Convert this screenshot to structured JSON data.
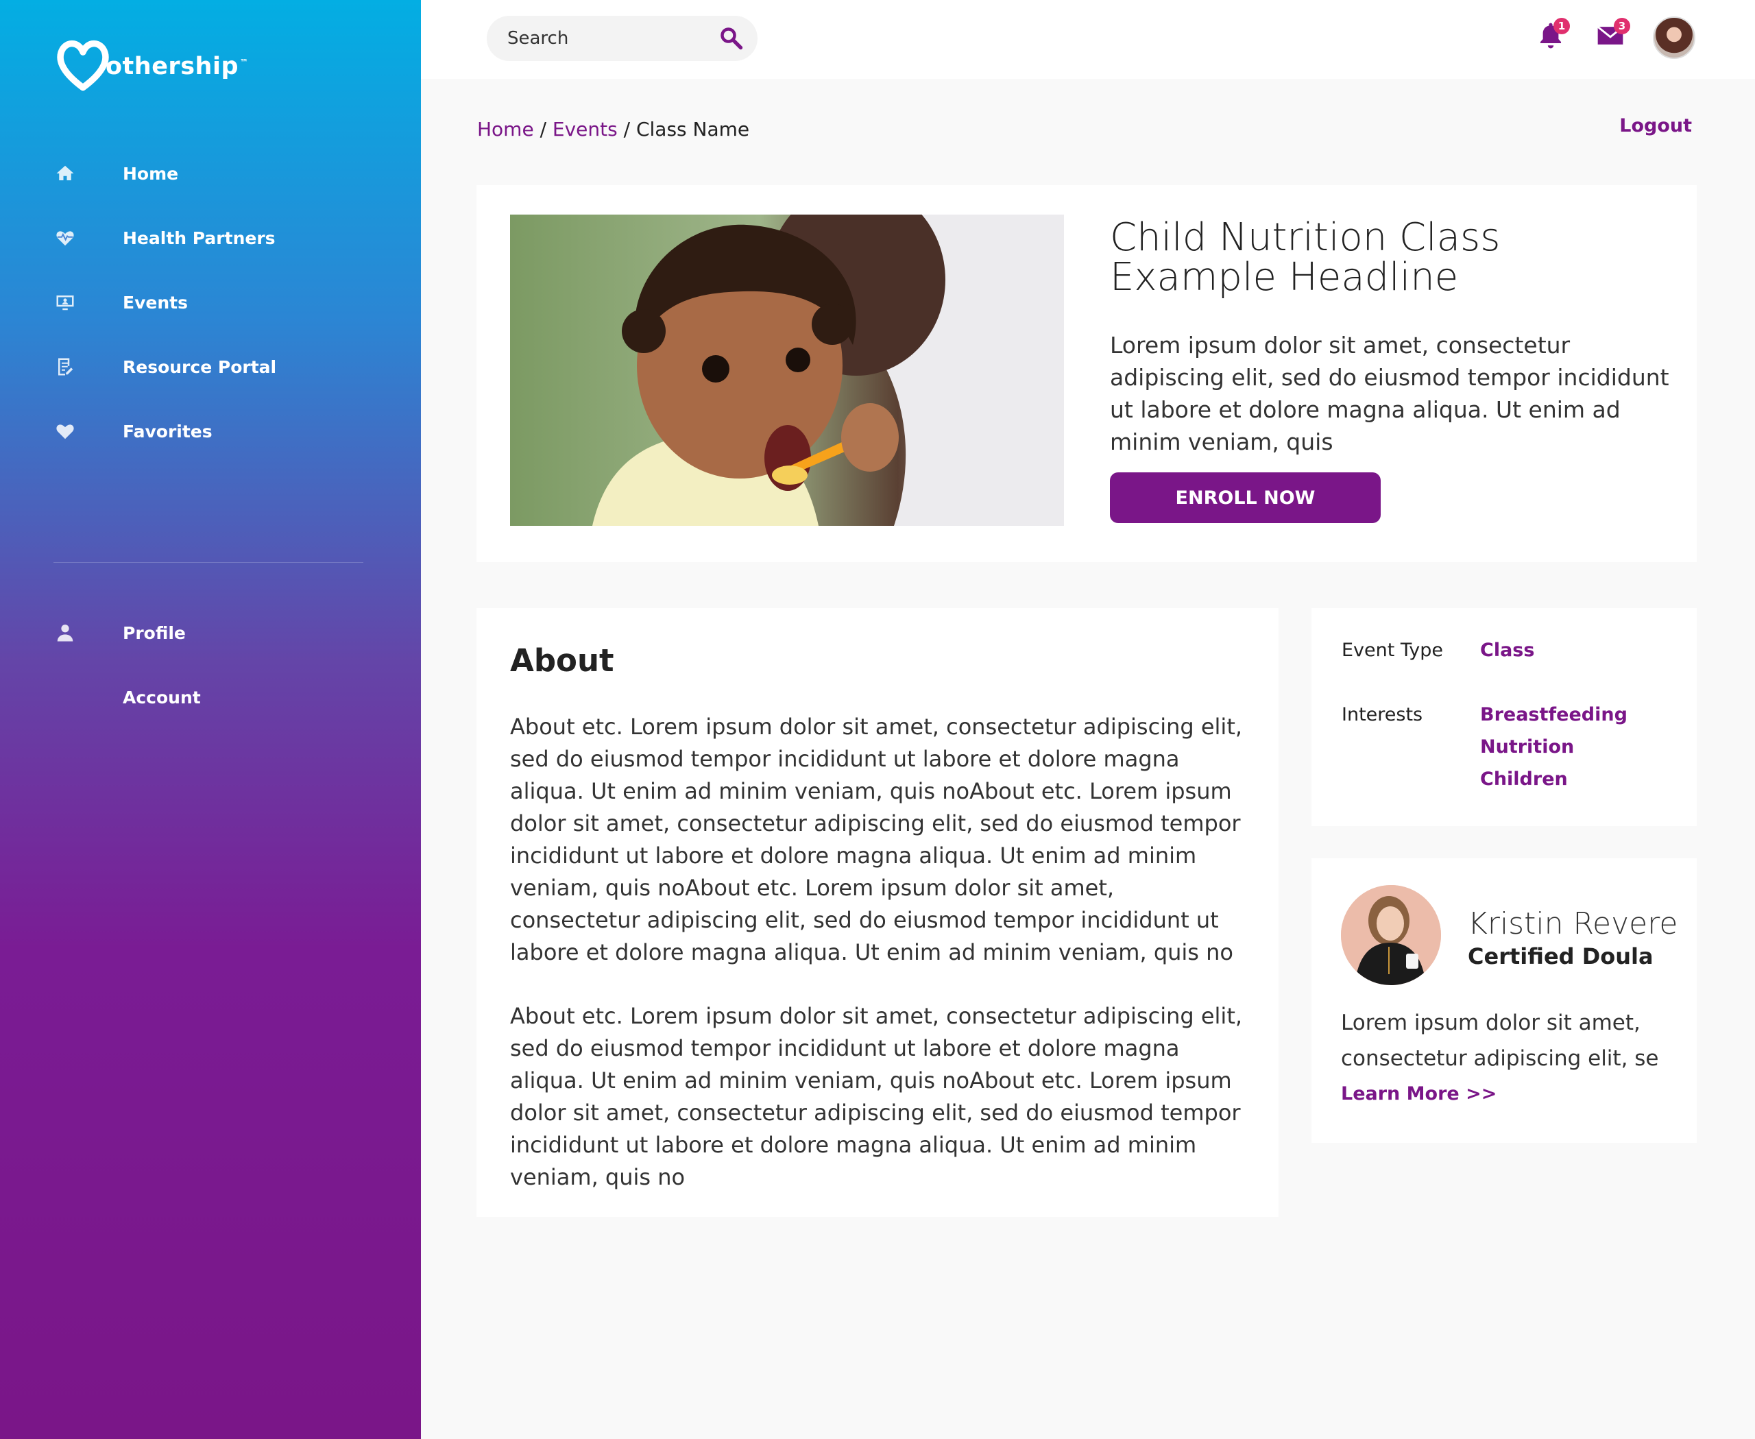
{
  "app": {
    "brand": "othership",
    "trademark": "™"
  },
  "sidebar": {
    "items": [
      {
        "label": "Home",
        "icon": "home-icon"
      },
      {
        "label": "Health Partners",
        "icon": "heart-pulse-icon"
      },
      {
        "label": "Events",
        "icon": "monitor-user-icon"
      },
      {
        "label": "Resource Portal",
        "icon": "document-edit-icon"
      },
      {
        "label": "Favorites",
        "icon": "heart-icon"
      }
    ],
    "account_items": [
      {
        "label": "Profile",
        "icon": "user-icon"
      },
      {
        "label": "Account"
      }
    ]
  },
  "topbar": {
    "search_placeholder": "Search",
    "notifications_count": "1",
    "messages_count": "3"
  },
  "breadcrumb": {
    "home": "Home",
    "sep1": " / ",
    "events": "Events",
    "sep2": " / ",
    "current": "Class Name"
  },
  "logout_label": "Logout",
  "hero": {
    "title": "Child Nutrition Class Example Headline",
    "description": "Lorem ipsum dolor sit amet, consectetur adipiscing elit, sed do eiusmod tempor incididunt ut labore et dolore magna aliqua. Ut enim ad minim veniam, quis",
    "enroll_label": "ENROLL NOW"
  },
  "about": {
    "title": "About",
    "paragraph1": "About etc. Lorem ipsum dolor sit amet, consectetur adipiscing elit, sed do eiusmod tempor incididunt ut labore et dolore magna aliqua. Ut enim ad minim veniam, quis noAbout etc. Lorem ipsum dolor sit amet, consectetur adipiscing elit, sed do eiusmod tempor incididunt ut labore et dolore magna aliqua. Ut enim ad minim veniam, quis noAbout etc. Lorem ipsum dolor sit amet, consectetur adipiscing elit, sed do eiusmod tempor incididunt ut labore et dolore magna aliqua. Ut enim ad minim veniam, quis no",
    "paragraph2": "About etc. Lorem ipsum dolor sit amet, consectetur adipiscing elit, sed do eiusmod tempor incididunt ut labore et dolore magna aliqua. Ut enim ad minim veniam, quis noAbout etc. Lorem ipsum dolor sit amet, consectetur adipiscing elit, sed do eiusmod tempor incididunt ut labore et dolore magna aliqua. Ut enim ad minim veniam, quis no"
  },
  "meta": {
    "event_type_label": "Event Type",
    "event_type_value": "Class",
    "interests_label": "Interests",
    "interests": [
      "Breastfeeding",
      "Nutrition",
      "Children"
    ]
  },
  "author": {
    "name": "Kristin Revere",
    "role": "Certified Doula",
    "bio": "Lorem ipsum dolor sit amet, consectetur adipiscing elit, se",
    "learn_more": "Learn More >>"
  },
  "colors": {
    "accent": "#7a1688",
    "sidebar_top": "#03aee3",
    "sidebar_bottom": "#7a1688",
    "badge": "#e0306e"
  }
}
